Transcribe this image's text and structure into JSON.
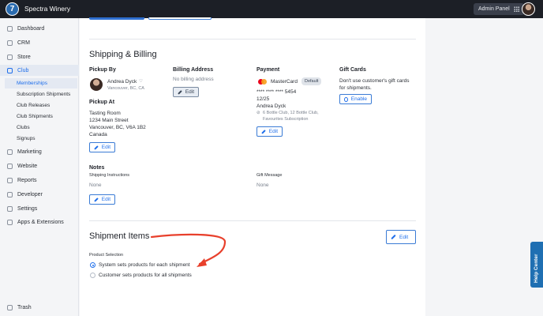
{
  "app": {
    "name": "Spectra Winery",
    "admin_panel_label": "Admin Panel"
  },
  "sidebar": {
    "items": [
      {
        "label": "Dashboard",
        "icon": "home-icon"
      },
      {
        "label": "CRM",
        "icon": "crm-icon"
      },
      {
        "label": "Store",
        "icon": "store-icon"
      },
      {
        "label": "Club",
        "icon": "club-icon"
      },
      {
        "label": "Marketing",
        "icon": "megaphone-icon"
      },
      {
        "label": "Website",
        "icon": "monitor-icon"
      },
      {
        "label": "Reports",
        "icon": "chart-icon"
      },
      {
        "label": "Developer",
        "icon": "wrench-icon"
      },
      {
        "label": "Settings",
        "icon": "gear-icon"
      },
      {
        "label": "Apps & Extensions",
        "icon": "apps-icon"
      }
    ],
    "club_subitems": [
      "Memberships",
      "Subscription Shipments",
      "Club Releases",
      "Club Shipments",
      "Clubs",
      "Signups"
    ],
    "trash_label": "Trash"
  },
  "shipping_billing": {
    "title": "Shipping & Billing",
    "pickup_by": {
      "label": "Pickup By",
      "name": "Andrea Dyck",
      "location": "Vancouver, BC, CA"
    },
    "pickup_at": {
      "label": "Pickup At",
      "lines": [
        "Tasting Room",
        "1234 Main Street",
        "Vancouver, BC, V6A 1B2",
        "Canada"
      ],
      "edit_label": "Edit"
    },
    "billing_address": {
      "label": "Billing Address",
      "value": "No billing address",
      "edit_label": "Edit"
    },
    "payment": {
      "label": "Payment",
      "card_brand": "MasterCard",
      "default_badge": "Default",
      "card_number": "**** **** **** 5454",
      "expiry": "12/25",
      "cardholder": "Andrea Dyck",
      "clubs_line1": "6 Bottle Club, 12 Bottle Club,",
      "clubs_line2": "Favourites Subscription",
      "edit_label": "Edit"
    },
    "gift_cards": {
      "label": "Gift Cards",
      "line1": "Don't use customer's gift cards",
      "line2": "for shipments.",
      "enable_label": "Enable"
    }
  },
  "notes": {
    "title": "Notes",
    "shipping_instructions_label": "Shipping Instructions",
    "shipping_instructions_value": "None",
    "gift_message_label": "Gift Message",
    "gift_message_value": "None",
    "edit_label": "Edit"
  },
  "shipment_items": {
    "title": "Shipment Items",
    "edit_label": "Edit",
    "product_selection_label": "Product Selection",
    "options": [
      {
        "label": "System sets products for each shipment",
        "selected": true
      },
      {
        "label": "Customer sets products for all shipments",
        "selected": false
      }
    ]
  },
  "help_center_label": "Help Center",
  "colors": {
    "accent": "#1f6feb",
    "annotation_arrow": "#e8402c",
    "topbar": "#1c1f26"
  }
}
